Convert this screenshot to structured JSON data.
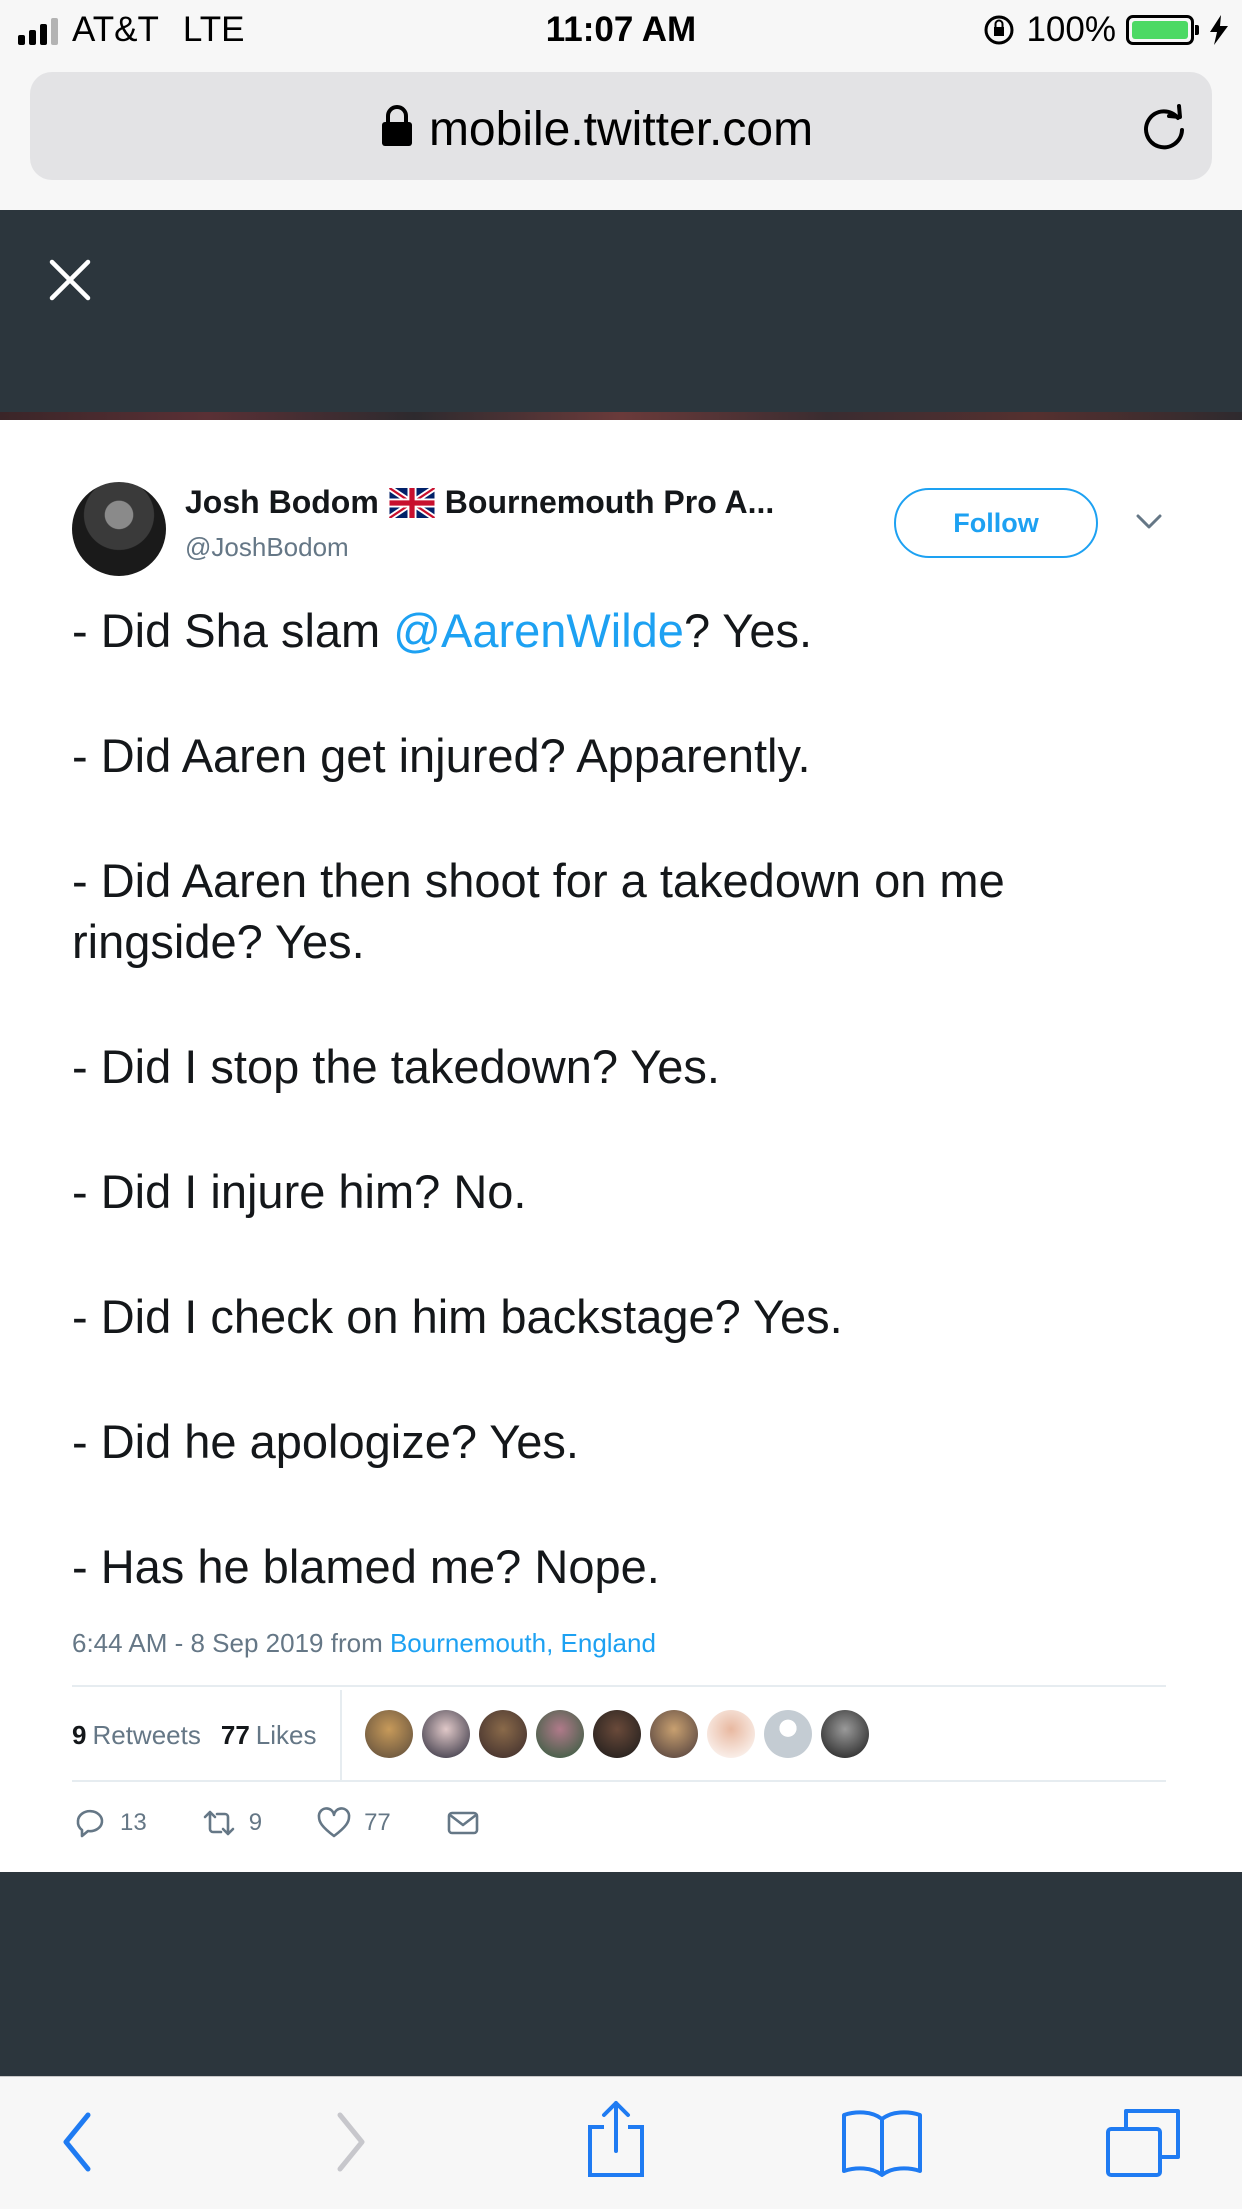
{
  "status_bar": {
    "carrier": "AT&T",
    "network": "LTE",
    "time": "11:07 AM",
    "battery": "100%",
    "battery_level": 1.0
  },
  "browser": {
    "url": "mobile.twitter.com",
    "icons": [
      "lock-icon",
      "reload-icon",
      "close-icon"
    ]
  },
  "tweet": {
    "author_name": "Josh Bodom",
    "author_name_suffix": "Bournemouth Pro A...",
    "handle": "@JoshBodom",
    "follow_label": "Follow",
    "lines": {
      "l1_pre": "- Did Sha slam ",
      "l1_mention": "@AarenWilde",
      "l1_post": "? Yes.",
      "l2": "- Did Aaren get injured? Apparently.",
      "l3": "- Did Aaren then shoot for a takedown on me ringside? Yes.",
      "l4": "- Did I stop the takedown? Yes.",
      "l5": "- Did I injure him? No.",
      "l6": "- Did I check on him backstage? Yes.",
      "l7": "- Did he apologize? Yes.",
      "l8": "- Has he blamed me? Nope."
    },
    "timestamp": "6:44 AM - 8 Sep 2019 from ",
    "location": "Bournemouth, England",
    "retweets_count": "9",
    "retweets_label": "Retweets",
    "likes_count": "77",
    "likes_label": "Likes",
    "actions": {
      "replies": "13",
      "retweets": "9",
      "likes": "77"
    }
  },
  "colors": {
    "accent": "#1da1f2",
    "overlay": "#2c363d",
    "text": "#14171a",
    "muted": "#657786"
  }
}
